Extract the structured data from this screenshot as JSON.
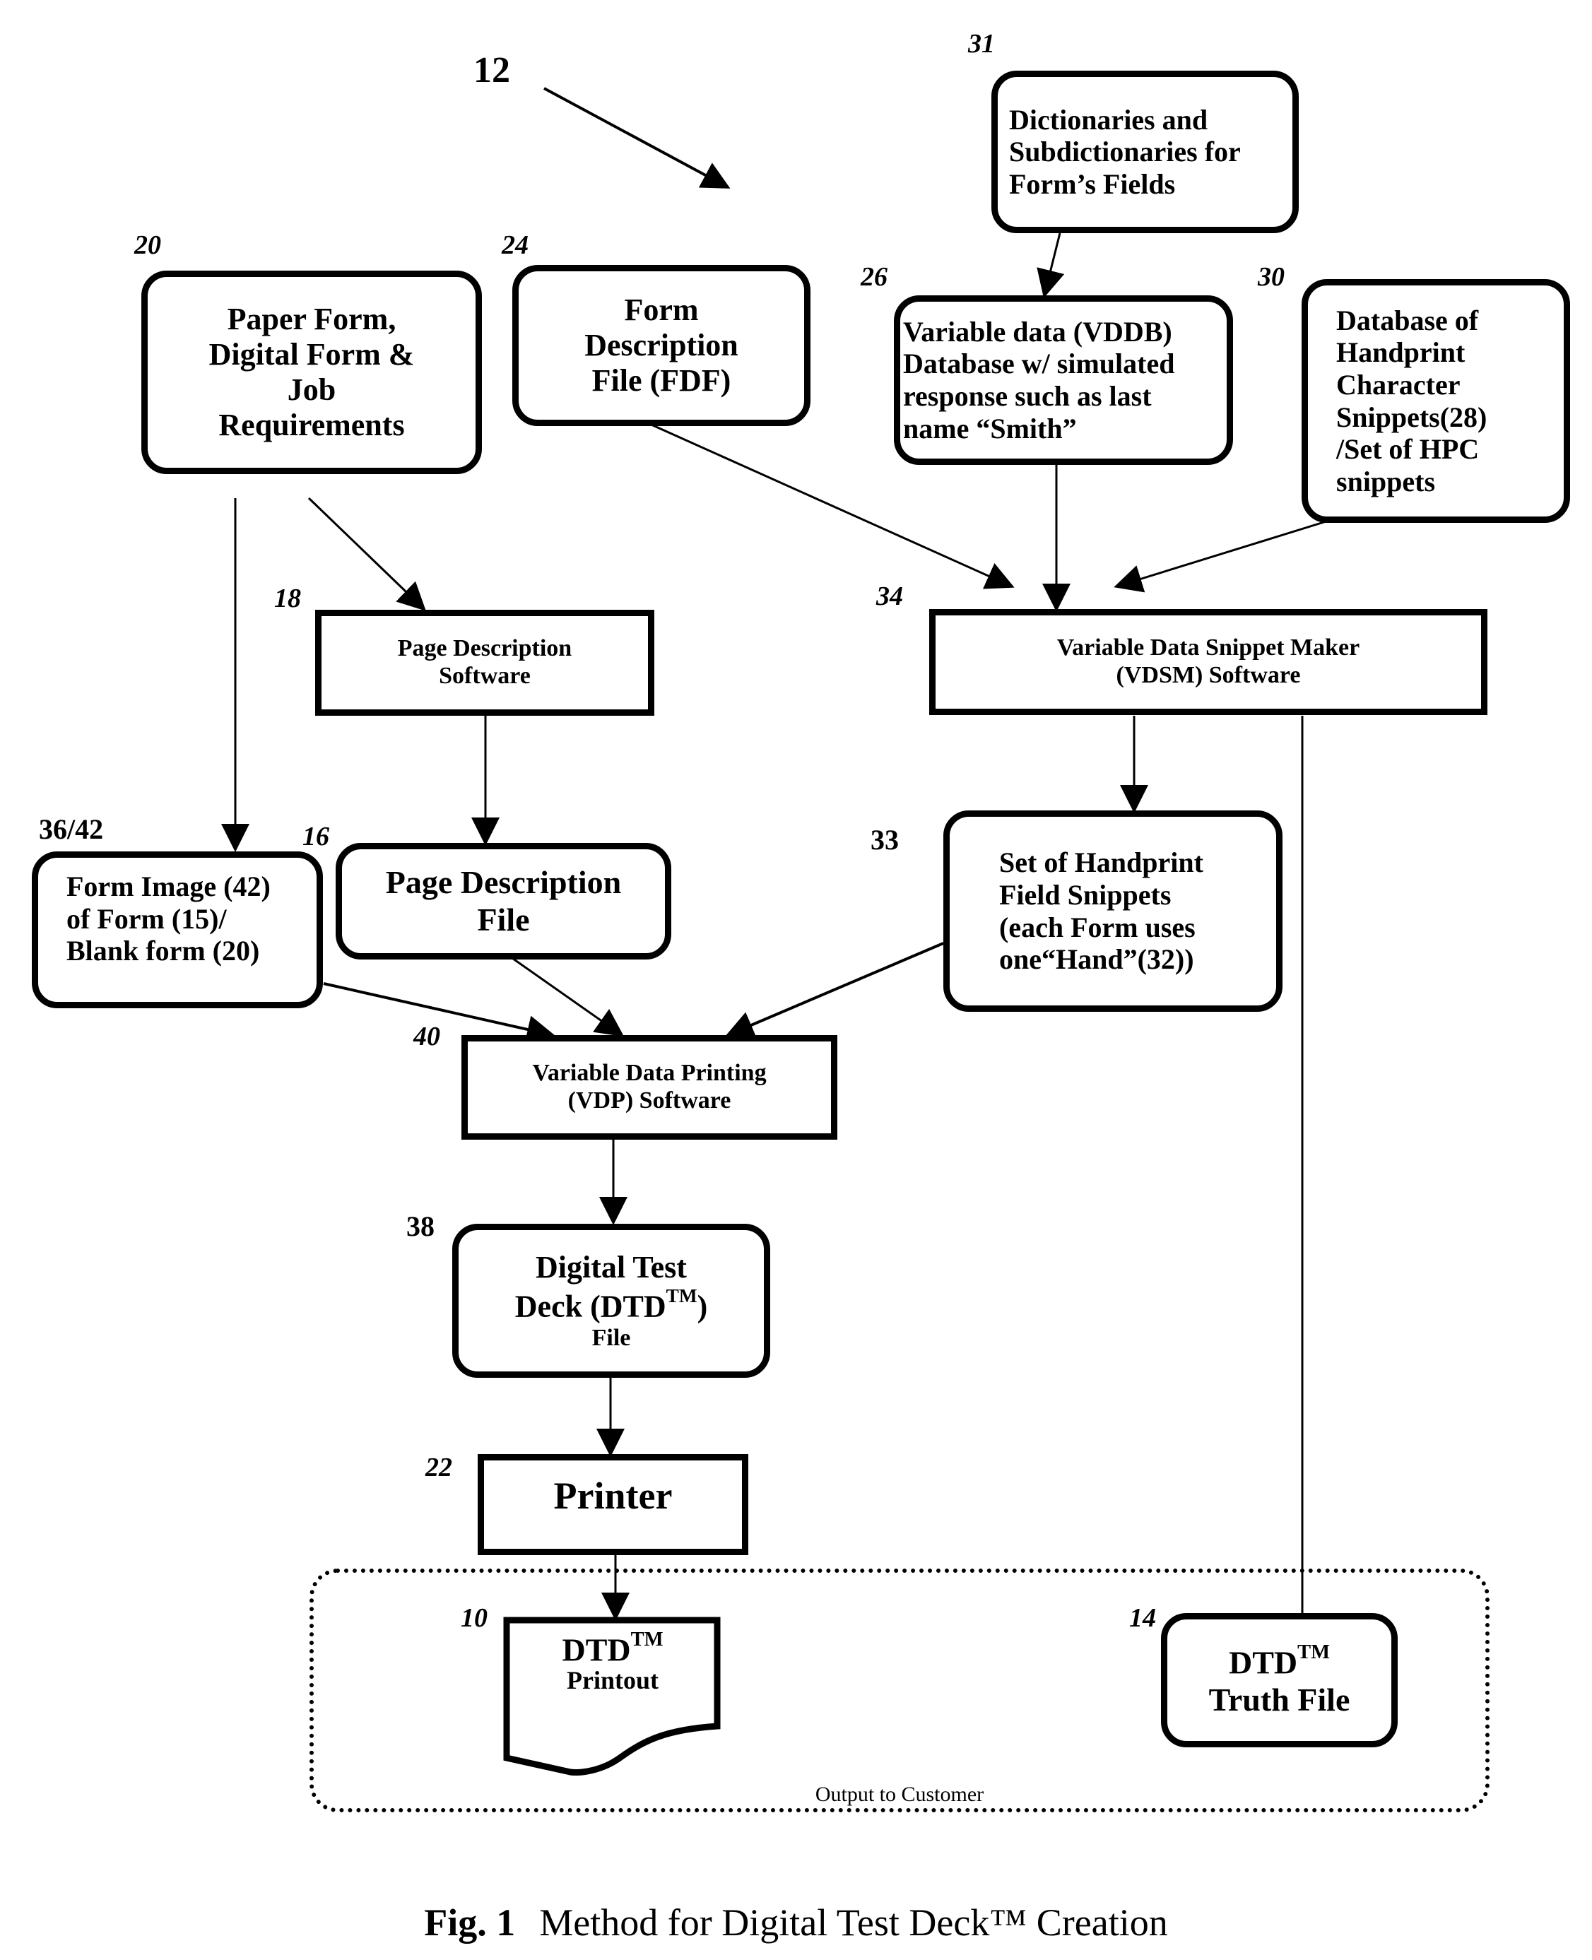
{
  "figure": {
    "number_label": "Fig. 1",
    "title": "Method for Digital Test Deck™ Creation",
    "overall_ref": "12"
  },
  "nodes": {
    "dictionaries": {
      "ref": "31",
      "text": "Dictionaries and\nSubdictionaries for\nForm’s Fields"
    },
    "paper_form": {
      "ref": "20",
      "text": "Paper Form,\nDigital Form &\nJob\nRequirements"
    },
    "fdf": {
      "ref": "24",
      "text": "Form\nDescription\nFile (FDF)"
    },
    "vddb": {
      "ref": "26",
      "text": "Variable data (VDDB)\nDatabase w/ simulated\nresponse such as last\n name “Smith”"
    },
    "hpc_db": {
      "ref": "30",
      "text": "Database of\nHandprint\nCharacter\nSnippets(28)\n/Set of HPC\nsnippets"
    },
    "page_desc_software": {
      "ref": "18",
      "text": "Page Description\nSoftware"
    },
    "vdsm": {
      "ref": "34",
      "text": "Variable Data Snippet Maker\n(VDSM) Software"
    },
    "form_image": {
      "ref": "36/42",
      "text": "Form Image (42)\nof Form (15)/\nBlank form (20)"
    },
    "page_desc_file": {
      "ref": "16",
      "text": "Page Description\nFile"
    },
    "handprint_set": {
      "ref": "33",
      "text": "Set of Handprint\nField Snippets\n(each Form uses\none“Hand”(32))"
    },
    "vdp": {
      "ref": "40",
      "text": "Variable Data Printing\n(VDP) Software"
    },
    "dtd_file": {
      "ref": "38",
      "line1": "Digital Test",
      "line2_pre": "Deck (DTD",
      "tm": "TM",
      "line2_post": ")",
      "line3": "File"
    },
    "printer": {
      "ref": "22",
      "text": "Printer"
    },
    "dtd_printout": {
      "ref": "10",
      "line1": "DTD",
      "tm": "TM",
      "line2": "Printout"
    },
    "truth_file": {
      "ref": "14",
      "line1": "DTD",
      "tm": "TM",
      "line2": "Truth File"
    }
  },
  "group": {
    "label": "Output to Customer"
  },
  "edges": [
    {
      "from": "dictionaries",
      "to": "vddb"
    },
    {
      "from": "paper_form",
      "to": "page_desc_software"
    },
    {
      "from": "paper_form",
      "to": "form_image"
    },
    {
      "from": "fdf",
      "to": "vdsm"
    },
    {
      "from": "vddb",
      "to": "vdsm"
    },
    {
      "from": "hpc_db",
      "to": "vdsm"
    },
    {
      "from": "page_desc_software",
      "to": "page_desc_file"
    },
    {
      "from": "vdsm",
      "to": "handprint_set"
    },
    {
      "from": "vdsm",
      "to": "truth_file",
      "arrow": false
    },
    {
      "from": "form_image",
      "to": "vdp"
    },
    {
      "from": "page_desc_file",
      "to": "vdp"
    },
    {
      "from": "handprint_set",
      "to": "vdp"
    },
    {
      "from": "vdp",
      "to": "dtd_file"
    },
    {
      "from": "dtd_file",
      "to": "printer"
    },
    {
      "from": "printer",
      "to": "dtd_printout"
    }
  ]
}
